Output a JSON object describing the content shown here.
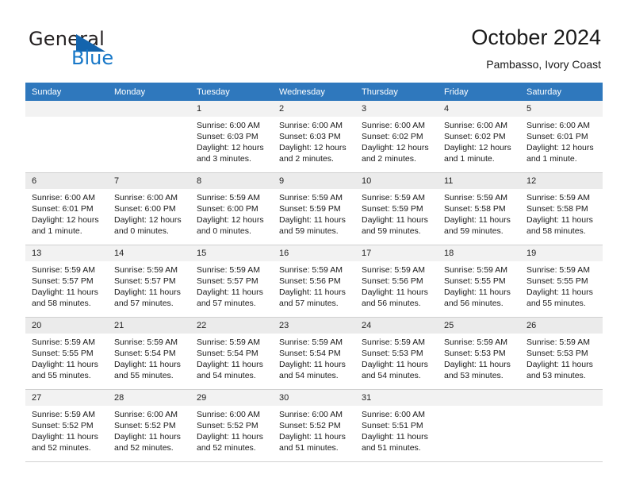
{
  "brand": {
    "word_one": "General",
    "word_two": "Blue",
    "triangle_icon": "triangle-logo-icon",
    "accent_color": "#1878c8",
    "triangle_color": "#1464ad"
  },
  "header": {
    "title": "October 2024",
    "subtitle": "Pambasso, Ivory Coast"
  },
  "calendar": {
    "header_bg": "#2f78bd",
    "header_text_color": "#ffffff",
    "daynum_bg": "#f2f2f2",
    "weekdays": [
      "Sunday",
      "Monday",
      "Tuesday",
      "Wednesday",
      "Thursday",
      "Friday",
      "Saturday"
    ],
    "weeks": [
      [
        {
          "day": "",
          "lines": []
        },
        {
          "day": "",
          "lines": []
        },
        {
          "day": "1",
          "lines": [
            "Sunrise: 6:00 AM",
            "Sunset: 6:03 PM",
            "Daylight: 12 hours",
            "and 3 minutes."
          ]
        },
        {
          "day": "2",
          "lines": [
            "Sunrise: 6:00 AM",
            "Sunset: 6:03 PM",
            "Daylight: 12 hours",
            "and 2 minutes."
          ]
        },
        {
          "day": "3",
          "lines": [
            "Sunrise: 6:00 AM",
            "Sunset: 6:02 PM",
            "Daylight: 12 hours",
            "and 2 minutes."
          ]
        },
        {
          "day": "4",
          "lines": [
            "Sunrise: 6:00 AM",
            "Sunset: 6:02 PM",
            "Daylight: 12 hours",
            "and 1 minute."
          ]
        },
        {
          "day": "5",
          "lines": [
            "Sunrise: 6:00 AM",
            "Sunset: 6:01 PM",
            "Daylight: 12 hours",
            "and 1 minute."
          ]
        }
      ],
      [
        {
          "day": "6",
          "lines": [
            "Sunrise: 6:00 AM",
            "Sunset: 6:01 PM",
            "Daylight: 12 hours",
            "and 1 minute."
          ]
        },
        {
          "day": "7",
          "lines": [
            "Sunrise: 6:00 AM",
            "Sunset: 6:00 PM",
            "Daylight: 12 hours",
            "and 0 minutes."
          ]
        },
        {
          "day": "8",
          "lines": [
            "Sunrise: 5:59 AM",
            "Sunset: 6:00 PM",
            "Daylight: 12 hours",
            "and 0 minutes."
          ]
        },
        {
          "day": "9",
          "lines": [
            "Sunrise: 5:59 AM",
            "Sunset: 5:59 PM",
            "Daylight: 11 hours",
            "and 59 minutes."
          ]
        },
        {
          "day": "10",
          "lines": [
            "Sunrise: 5:59 AM",
            "Sunset: 5:59 PM",
            "Daylight: 11 hours",
            "and 59 minutes."
          ]
        },
        {
          "day": "11",
          "lines": [
            "Sunrise: 5:59 AM",
            "Sunset: 5:58 PM",
            "Daylight: 11 hours",
            "and 59 minutes."
          ]
        },
        {
          "day": "12",
          "lines": [
            "Sunrise: 5:59 AM",
            "Sunset: 5:58 PM",
            "Daylight: 11 hours",
            "and 58 minutes."
          ]
        }
      ],
      [
        {
          "day": "13",
          "lines": [
            "Sunrise: 5:59 AM",
            "Sunset: 5:57 PM",
            "Daylight: 11 hours",
            "and 58 minutes."
          ]
        },
        {
          "day": "14",
          "lines": [
            "Sunrise: 5:59 AM",
            "Sunset: 5:57 PM",
            "Daylight: 11 hours",
            "and 57 minutes."
          ]
        },
        {
          "day": "15",
          "lines": [
            "Sunrise: 5:59 AM",
            "Sunset: 5:57 PM",
            "Daylight: 11 hours",
            "and 57 minutes."
          ]
        },
        {
          "day": "16",
          "lines": [
            "Sunrise: 5:59 AM",
            "Sunset: 5:56 PM",
            "Daylight: 11 hours",
            "and 57 minutes."
          ]
        },
        {
          "day": "17",
          "lines": [
            "Sunrise: 5:59 AM",
            "Sunset: 5:56 PM",
            "Daylight: 11 hours",
            "and 56 minutes."
          ]
        },
        {
          "day": "18",
          "lines": [
            "Sunrise: 5:59 AM",
            "Sunset: 5:55 PM",
            "Daylight: 11 hours",
            "and 56 minutes."
          ]
        },
        {
          "day": "19",
          "lines": [
            "Sunrise: 5:59 AM",
            "Sunset: 5:55 PM",
            "Daylight: 11 hours",
            "and 55 minutes."
          ]
        }
      ],
      [
        {
          "day": "20",
          "lines": [
            "Sunrise: 5:59 AM",
            "Sunset: 5:55 PM",
            "Daylight: 11 hours",
            "and 55 minutes."
          ]
        },
        {
          "day": "21",
          "lines": [
            "Sunrise: 5:59 AM",
            "Sunset: 5:54 PM",
            "Daylight: 11 hours",
            "and 55 minutes."
          ]
        },
        {
          "day": "22",
          "lines": [
            "Sunrise: 5:59 AM",
            "Sunset: 5:54 PM",
            "Daylight: 11 hours",
            "and 54 minutes."
          ]
        },
        {
          "day": "23",
          "lines": [
            "Sunrise: 5:59 AM",
            "Sunset: 5:54 PM",
            "Daylight: 11 hours",
            "and 54 minutes."
          ]
        },
        {
          "day": "24",
          "lines": [
            "Sunrise: 5:59 AM",
            "Sunset: 5:53 PM",
            "Daylight: 11 hours",
            "and 54 minutes."
          ]
        },
        {
          "day": "25",
          "lines": [
            "Sunrise: 5:59 AM",
            "Sunset: 5:53 PM",
            "Daylight: 11 hours",
            "and 53 minutes."
          ]
        },
        {
          "day": "26",
          "lines": [
            "Sunrise: 5:59 AM",
            "Sunset: 5:53 PM",
            "Daylight: 11 hours",
            "and 53 minutes."
          ]
        }
      ],
      [
        {
          "day": "27",
          "lines": [
            "Sunrise: 5:59 AM",
            "Sunset: 5:52 PM",
            "Daylight: 11 hours",
            "and 52 minutes."
          ]
        },
        {
          "day": "28",
          "lines": [
            "Sunrise: 6:00 AM",
            "Sunset: 5:52 PM",
            "Daylight: 11 hours",
            "and 52 minutes."
          ]
        },
        {
          "day": "29",
          "lines": [
            "Sunrise: 6:00 AM",
            "Sunset: 5:52 PM",
            "Daylight: 11 hours",
            "and 52 minutes."
          ]
        },
        {
          "day": "30",
          "lines": [
            "Sunrise: 6:00 AM",
            "Sunset: 5:52 PM",
            "Daylight: 11 hours",
            "and 51 minutes."
          ]
        },
        {
          "day": "31",
          "lines": [
            "Sunrise: 6:00 AM",
            "Sunset: 5:51 PM",
            "Daylight: 11 hours",
            "and 51 minutes."
          ]
        },
        {
          "day": "",
          "lines": []
        },
        {
          "day": "",
          "lines": []
        }
      ]
    ]
  }
}
